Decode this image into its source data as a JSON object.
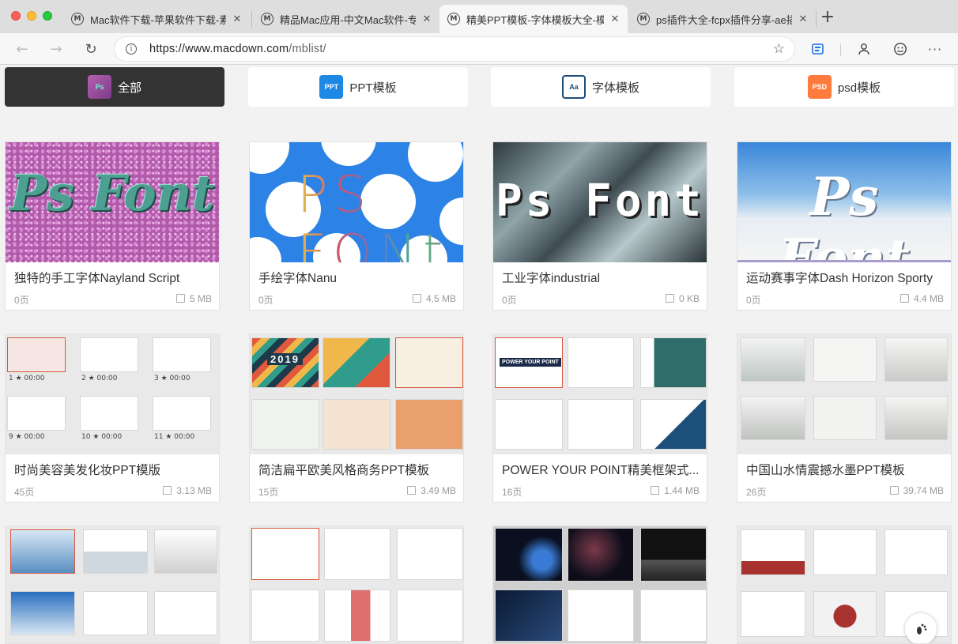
{
  "browser": {
    "tabs": [
      {
        "title": "Mac软件下载-苹果软件下载-素材",
        "active": false
      },
      {
        "title": "精品Mac应用-中文Mac软件-专",
        "active": false
      },
      {
        "title": "精美PPT模板-字体模板大全-模",
        "active": true
      },
      {
        "title": "ps插件大全-fcpx插件分享-ae插",
        "active": false
      }
    ],
    "new_tab": "+",
    "url_host": "https://www.macdown.com",
    "url_path": "/mblist/"
  },
  "categories": [
    {
      "label": "全部",
      "icon": "all-templates-icon",
      "active": true
    },
    {
      "label": "PPT模板",
      "icon": "ppt-icon",
      "active": false
    },
    {
      "label": "字体模板",
      "icon": "font-icon",
      "active": false
    },
    {
      "label": "psd模板",
      "icon": "psd-icon",
      "active": false
    }
  ],
  "cards": [
    {
      "title": "独特的手工字体Nayland Script",
      "pages": "0页",
      "size": "5 MB",
      "thumb_text": "Ps Font"
    },
    {
      "title": "手绘字体Nanu",
      "pages": "0页",
      "size": "4.5 MB",
      "thumb_text": "PS FONt"
    },
    {
      "title": "工业字体industrial",
      "pages": "0页",
      "size": "0 KB",
      "thumb_text": "Ps Font"
    },
    {
      "title": "运动赛事字体Dash Horizon Sporty",
      "pages": "0页",
      "size": "4.4 MB",
      "thumb_text": "Ps Font"
    },
    {
      "title": "时尚美容美发化妆PPT模版",
      "pages": "45页",
      "size": "3.13 MB",
      "slide_captions": [
        "1 ★ 00:00",
        "2 ★ 00:00",
        "3 ★ 00:00",
        "9 ★ 00:00",
        "10 ★ 00:00",
        "11 ★ 00:00"
      ]
    },
    {
      "title": "简洁扁平欧美风格商务PPT模板",
      "pages": "15页",
      "size": "3.49 MB",
      "thumb_text": "2019"
    },
    {
      "title": "POWER YOUR POINT精美框架式...",
      "pages": "16页",
      "size": "1.44 MB",
      "thumb_text": "POWER YOUR POINT"
    },
    {
      "title": "中国山水情震撼水墨PPT模板",
      "pages": "26页",
      "size": "39.74 MB"
    }
  ]
}
